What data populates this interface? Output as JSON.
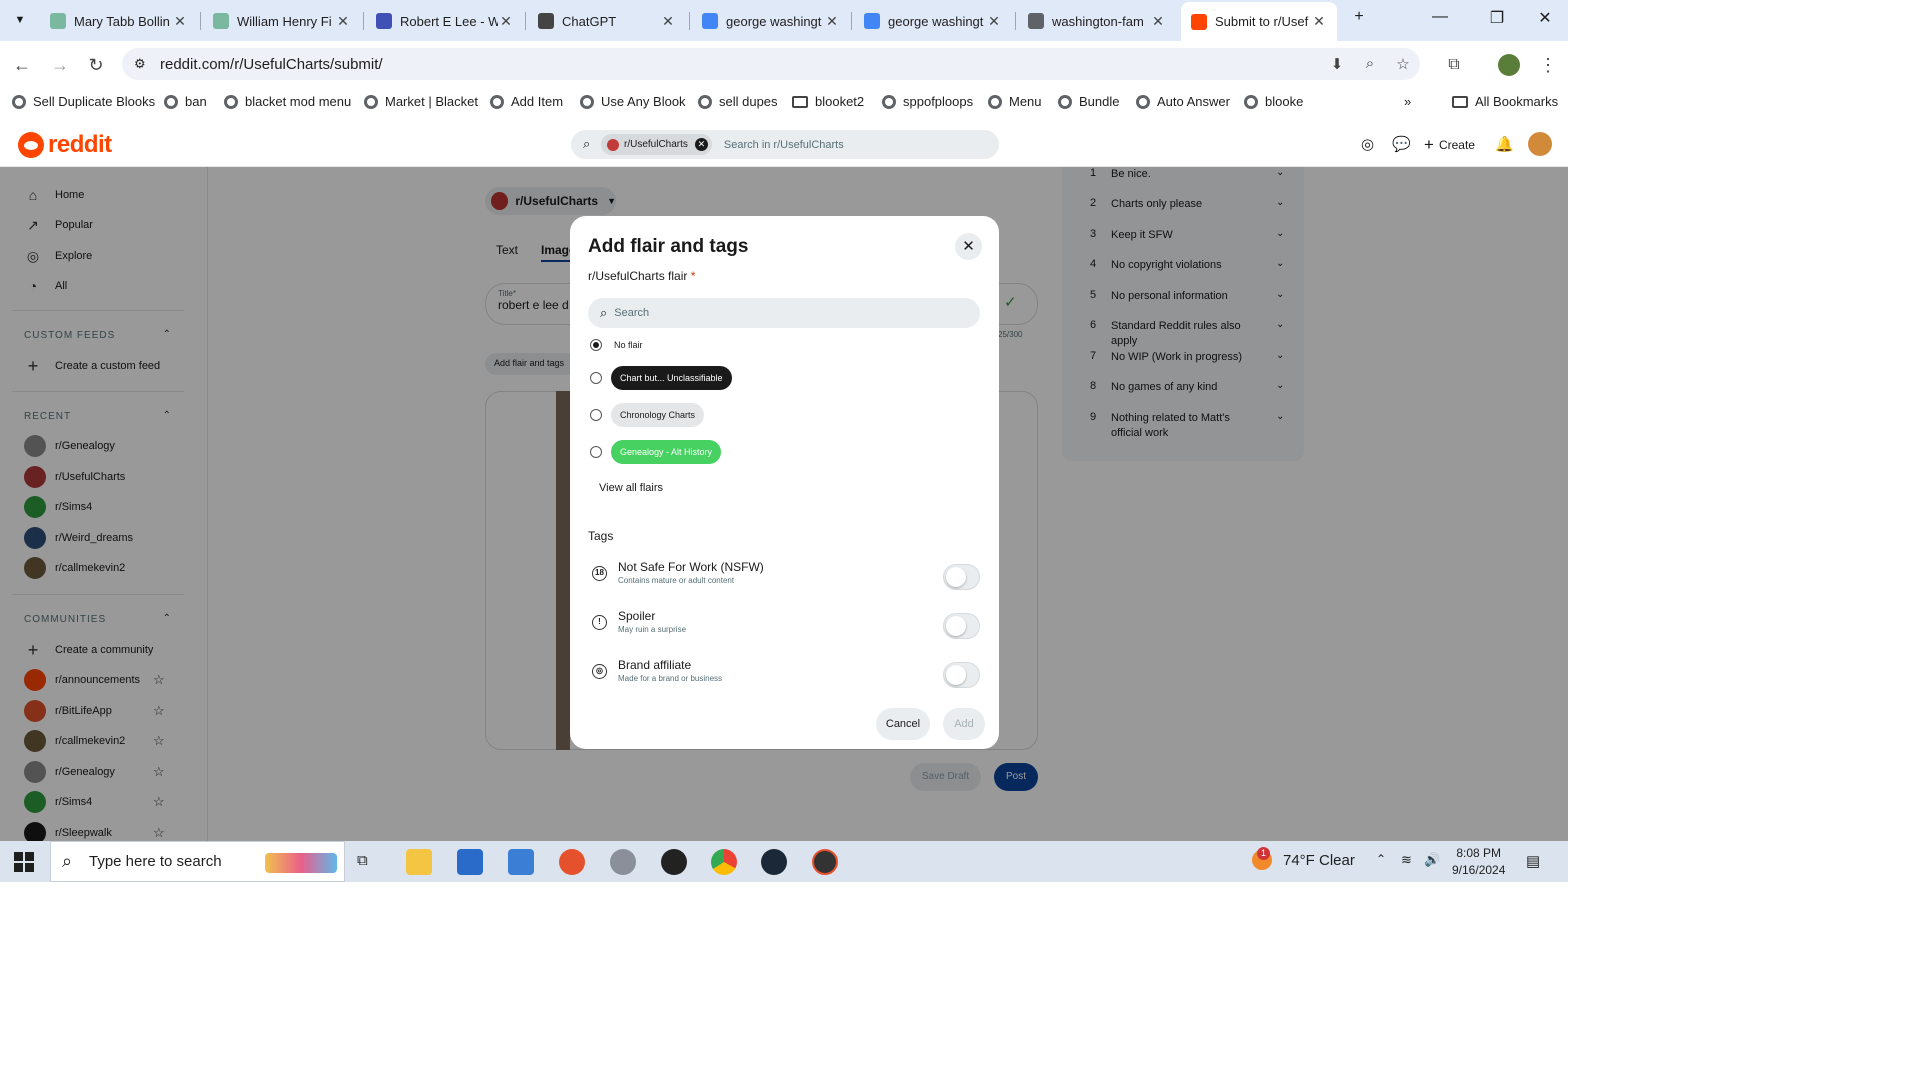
{
  "browser": {
    "tabs": [
      {
        "title": "Mary Tabb Bollin",
        "fav_color": "#7ab8a0",
        "active": false
      },
      {
        "title": "William Henry Fi",
        "fav_color": "#7ab8a0",
        "active": false
      },
      {
        "title": "Robert E Lee - W",
        "fav_color": "#3f51b5",
        "active": false
      },
      {
        "title": "ChatGPT",
        "fav_color": "#444444",
        "active": false
      },
      {
        "title": "george washingt",
        "fav_color": "#4285f4",
        "active": false
      },
      {
        "title": "george washingt",
        "fav_color": "#4285f4",
        "active": false
      },
      {
        "title": "washington-fam",
        "fav_color": "#5f6368",
        "active": false
      },
      {
        "title": "Submit to r/Usef",
        "fav_color": "#ff4500",
        "active": true
      }
    ],
    "url": "reddit.com/r/UsefulCharts/submit/",
    "bookmarks": [
      "Sell Duplicate Blooks",
      "ban",
      "blacket mod menu",
      "Market | Blacket",
      "Add Item",
      "Use Any Blook",
      "sell dupes",
      "blooket2",
      "sppofploops",
      "Menu",
      "Bundle",
      "Auto Answer",
      "blooke"
    ],
    "all_bookmarks": "All Bookmarks"
  },
  "reddit": {
    "logo_text": "reddit",
    "search_chip": "r/UsefulCharts",
    "search_placeholder": "Search in r/UsefulCharts",
    "create_label": "Create"
  },
  "sidebar": {
    "nav": [
      "Home",
      "Popular",
      "Explore",
      "All"
    ],
    "custom_feeds_heading": "CUSTOM FEEDS",
    "create_feed": "Create a custom feed",
    "recent_heading": "RECENT",
    "recent": [
      {
        "name": "r/Genealogy",
        "color": "#8a8a8a"
      },
      {
        "name": "r/UsefulCharts",
        "color": "#b03a3a"
      },
      {
        "name": "r/Sims4",
        "color": "#2e9b3e"
      },
      {
        "name": "r/Weird_dreams",
        "color": "#2d4f7a"
      },
      {
        "name": "r/callmekevin2",
        "color": "#6b5a3a"
      }
    ],
    "communities_heading": "COMMUNITIES",
    "create_community": "Create a community",
    "communities": [
      {
        "name": "r/announcements",
        "color": "#ff4500"
      },
      {
        "name": "r/BitLifeApp",
        "color": "#e0502a"
      },
      {
        "name": "r/callmekevin2",
        "color": "#6b5a3a"
      },
      {
        "name": "r/Genealogy",
        "color": "#8a8a8a"
      },
      {
        "name": "r/Sims4",
        "color": "#2e9b3e"
      },
      {
        "name": "r/Sleepwalk",
        "color": "#1a1a1b"
      }
    ]
  },
  "composer": {
    "community": "r/UsefulCharts",
    "tab_text": "Text",
    "tab_images": "Image",
    "title_label": "Title*",
    "title_value": "robert e lee d",
    "char_count": "25/300",
    "flair_button": "Add flair and tags",
    "save_draft": "Save Draft",
    "post": "Post"
  },
  "rules": [
    {
      "n": "1",
      "text": "Be nice."
    },
    {
      "n": "2",
      "text": "Charts only please"
    },
    {
      "n": "3",
      "text": "Keep it SFW"
    },
    {
      "n": "4",
      "text": "No copyright violations"
    },
    {
      "n": "5",
      "text": "No personal information"
    },
    {
      "n": "6",
      "text": "Standard Reddit rules also apply"
    },
    {
      "n": "7",
      "text": "No WIP (Work in progress)"
    },
    {
      "n": "8",
      "text": "No games of any kind"
    },
    {
      "n": "9",
      "text": "Nothing related to Matt's official work"
    }
  ],
  "modal": {
    "title": "Add flair and tags",
    "flair_label": "r/UsefulCharts flair",
    "required_mark": "*",
    "search_placeholder": "Search",
    "no_flair": "No flair",
    "flairs": [
      {
        "label": "Chart but... Unclassifiable",
        "bg": "#1a1a1b",
        "fg": "#ffffff"
      },
      {
        "label": "Chronology Charts",
        "bg": "#e4e6e8",
        "fg": "#1a1a1b"
      },
      {
        "label": "Genealogy - Alt History",
        "bg": "#46d160",
        "fg": "#ffffff"
      }
    ],
    "view_all": "View all flairs",
    "tags_heading": "Tags",
    "tags": [
      {
        "name": "Not Safe For Work (NSFW)",
        "desc": "Contains mature or adult content",
        "icon": "18",
        "on": false
      },
      {
        "name": "Spoiler",
        "desc": "May ruin a surprise",
        "icon": "!",
        "on": false
      },
      {
        "name": "Brand affiliate",
        "desc": "Made for a brand or business",
        "icon": "◎",
        "on": false
      }
    ],
    "cancel": "Cancel",
    "add": "Add"
  },
  "taskbar": {
    "search_placeholder": "Type here to search",
    "weather": "74°F  Clear",
    "weather_badge": "1",
    "time": "8:08 PM",
    "date": "9/16/2024"
  }
}
